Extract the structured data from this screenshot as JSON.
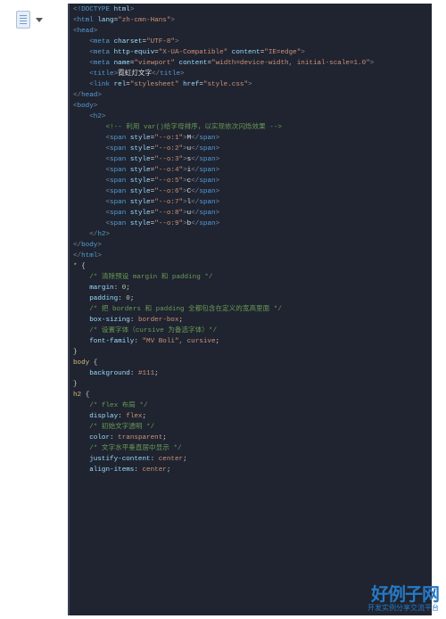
{
  "html": {
    "doctypeKw": "!DOCTYPE",
    "doctypeV": "html",
    "htmlTag": "html",
    "langAttr": "lang",
    "lang": "zh-cmn-Hans",
    "headTag": "head",
    "meta": "meta",
    "charsetAttr": "charset",
    "charset": "UTF-8",
    "httpEquivAttr": "http-equiv",
    "httpEquiv": "X-UA-Compatible",
    "contentAttr": "content",
    "xua": "IE=edge",
    "nameAttr": "name",
    "viewportName": "viewport",
    "viewportContent": "width=device-width, initial-scale=1.0",
    "titleTag": "title",
    "titleText": "霓虹灯文字",
    "linkTag": "link",
    "relAttr": "rel",
    "rel": "stylesheet",
    "hrefAttr": "href",
    "href": "style.css",
    "bodyTag": "body",
    "h2Tag": "h2",
    "comment": "<!-- 利用 var()给字母排序，以实现依次闪烁效果 -->",
    "spanTag": "span",
    "styleAttr": "style",
    "spans": [
      {
        "s": "--o:1",
        "t": "M"
      },
      {
        "s": "--o:2",
        "t": "u"
      },
      {
        "s": "--o:3",
        "t": "s"
      },
      {
        "s": "--o:4",
        "t": "i"
      },
      {
        "s": "--o:5",
        "t": "c"
      },
      {
        "s": "--o:6",
        "t": "C"
      },
      {
        "s": "--o:7",
        "t": "l"
      },
      {
        "s": "--o:8",
        "t": "u"
      },
      {
        "s": "--o:9",
        "t": "b"
      }
    ]
  },
  "css": {
    "selStar": "*",
    "cStar": "/* 清除预设 margin 和 padding */",
    "margin": "margin",
    "zero": "0",
    "padding": "padding",
    "cBox": "/* 把 borders 和 padding 全都包含在定义的宽高里面 */",
    "boxSizing": "box-sizing",
    "borderBox": "border-box",
    "cFont": "/* 设置字体（cursive 为备选字体）*/",
    "fontFamily": "font-family",
    "fontVal": "\"MV Boli\", cursive",
    "selBody": "body",
    "background": "background",
    "bg": "#111",
    "selH2": "h2",
    "cFlex": "/* flex 布局 */",
    "display": "display",
    "flex": "flex",
    "cTrans": "/* 初始文字透明 */",
    "color": "color",
    "transparent": "transparent",
    "cCenter": "/* 文字水平垂直居中显示 */",
    "justify": "justify-content",
    "center": "center",
    "align": "align-items"
  },
  "wm": {
    "big": "好例子网",
    "small": "开发实例分享交流平台"
  }
}
